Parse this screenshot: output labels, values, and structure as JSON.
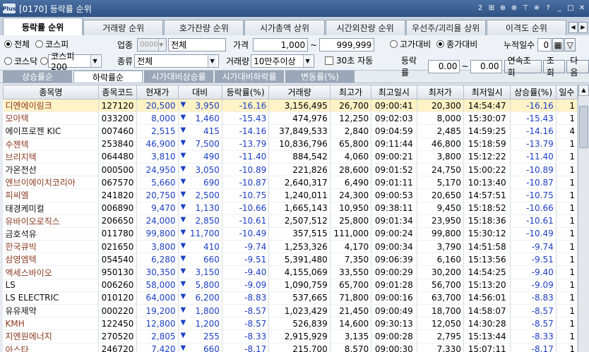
{
  "window": {
    "logo": "Plus",
    "title": "[0170] 등락률 순위"
  },
  "titlebar_icons": [
    "2",
    "⊞",
    "⊕",
    "⊗",
    "⊤",
    "※",
    "?",
    "_",
    "□",
    "✕"
  ],
  "tabs": [
    "등락률 순위",
    "거래량 순위",
    "호가잔량 순위",
    "시가총액 상위",
    "시간외잔량 순위",
    "우선주/괴리율 상위",
    "이격도 순위"
  ],
  "controls": {
    "market_all": "전체",
    "market_kospi": "코스피",
    "market_kosdaq": "코스닥",
    "market_kospi200": "코스피200",
    "industry_label": "업종",
    "industry_code": "0000",
    "industry_name": "전체",
    "type_label": "종류",
    "type_value": "전체",
    "price_label": "가격",
    "price_from": "1,000",
    "price_to": "999,999",
    "volume_label": "거래량",
    "volume_value": "10만주이상",
    "auto_label": "30초 자동",
    "vs_high": "고가대비",
    "vs_close": "종가대비",
    "days_label": "누적일수",
    "days_value": "0",
    "rate_label": "등락률",
    "rate_from": "0.00",
    "rate_to": "0.00",
    "btn_continuous": "연속조회",
    "btn_query": "조회",
    "btn_next": "다음",
    "tilde": "~"
  },
  "subtabs": [
    "상승률순",
    "하락률순",
    "시가대비상승률",
    "시가대비하락률",
    "변동률(%)"
  ],
  "columns": [
    "종목명",
    "종목코드",
    "현재가",
    "대비",
    "등락률(%)",
    "거래량",
    "최고가",
    "최고일시",
    "최저가",
    "최저일시",
    "상승률(%)",
    "일수"
  ],
  "rows": [
    {
      "name": "디엔에이링크",
      "code": "127120",
      "price": "20,500",
      "change": "3,950",
      "rate": "-16.16",
      "volume": "3,156,495",
      "high": "26,700",
      "high_time": "09:00:41",
      "low": "20,300",
      "low_time": "14:54:47",
      "up_rate": "-16.16",
      "days": "1",
      "kosdaq": true
    },
    {
      "name": "모아텍",
      "code": "033200",
      "price": "8,000",
      "change": "1,460",
      "rate": "-15.43",
      "volume": "474,976",
      "high": "12,250",
      "high_time": "09:02:03",
      "low": "8,000",
      "low_time": "15:30:07",
      "up_rate": "-15.43",
      "days": "1",
      "kosdaq": true
    },
    {
      "name": "에이프로젠 KIC",
      "code": "007460",
      "price": "2,515",
      "change": "415",
      "rate": "-14.16",
      "volume": "37,849,533",
      "high": "2,840",
      "high_time": "09:04:59",
      "low": "2,485",
      "low_time": "14:59:25",
      "up_rate": "-14.16",
      "days": "4",
      "kosdaq": false
    },
    {
      "name": "수젠텍",
      "code": "253840",
      "price": "46,900",
      "change": "7,500",
      "rate": "-13.79",
      "volume": "10,836,796",
      "high": "65,800",
      "high_time": "09:11:44",
      "low": "46,800",
      "low_time": "15:18:59",
      "up_rate": "-13.79",
      "days": "1",
      "kosdaq": true
    },
    {
      "name": "브리지텍",
      "code": "064480",
      "price": "3,810",
      "change": "490",
      "rate": "-11.40",
      "volume": "884,542",
      "high": "4,060",
      "high_time": "09:00:21",
      "low": "3,800",
      "low_time": "15:12:22",
      "up_rate": "-11.40",
      "days": "1",
      "kosdaq": true
    },
    {
      "name": "가온전선",
      "code": "000500",
      "price": "24,950",
      "change": "3,050",
      "rate": "-10.89",
      "volume": "221,826",
      "high": "28,600",
      "high_time": "09:01:52",
      "low": "24,750",
      "low_time": "15:00:22",
      "up_rate": "-10.89",
      "days": "1",
      "kosdaq": false
    },
    {
      "name": "엔브이에이치코리아",
      "code": "067570",
      "price": "5,660",
      "change": "690",
      "rate": "-10.87",
      "volume": "2,640,317",
      "high": "6,490",
      "high_time": "09:01:11",
      "low": "5,170",
      "low_time": "10:13:40",
      "up_rate": "-10.87",
      "days": "1",
      "kosdaq": true
    },
    {
      "name": "피씨엘",
      "code": "241820",
      "price": "20,750",
      "change": "2,500",
      "rate": "-10.75",
      "volume": "1,240,011",
      "high": "24,300",
      "high_time": "09:00:53",
      "low": "20,650",
      "low_time": "14:57:51",
      "up_rate": "-10.75",
      "days": "1",
      "kosdaq": true
    },
    {
      "name": "태경케미컬",
      "code": "006890",
      "price": "9,470",
      "change": "1,130",
      "rate": "-10.66",
      "volume": "1,665,143",
      "high": "10,950",
      "high_time": "09:38:11",
      "low": "9,450",
      "low_time": "15:18:52",
      "up_rate": "-10.66",
      "days": "1",
      "kosdaq": false
    },
    {
      "name": "유바이오로직스",
      "code": "206650",
      "price": "24,000",
      "change": "2,850",
      "rate": "-10.61",
      "volume": "2,507,512",
      "high": "25,800",
      "high_time": "09:01:34",
      "low": "23,950",
      "low_time": "15:18:36",
      "up_rate": "-10.61",
      "days": "1",
      "kosdaq": true
    },
    {
      "name": "금호석유",
      "code": "011780",
      "price": "99,800",
      "change": "11,700",
      "rate": "-10.49",
      "volume": "357,515",
      "high": "111,000",
      "high_time": "09:00:24",
      "low": "99,800",
      "low_time": "15:30:12",
      "up_rate": "-10.49",
      "days": "1",
      "kosdaq": false
    },
    {
      "name": "한국큐빅",
      "code": "021650",
      "price": "3,800",
      "change": "410",
      "rate": "-9.74",
      "volume": "1,253,326",
      "high": "4,170",
      "high_time": "09:00:34",
      "low": "3,790",
      "low_time": "14:51:58",
      "up_rate": "-9.74",
      "days": "1",
      "kosdaq": true
    },
    {
      "name": "삼영엠텍",
      "code": "054540",
      "price": "6,280",
      "change": "660",
      "rate": "-9.51",
      "volume": "5,391,480",
      "high": "7,350",
      "high_time": "09:06:39",
      "low": "6,160",
      "low_time": "15:13:56",
      "up_rate": "-9.51",
      "days": "1",
      "kosdaq": true
    },
    {
      "name": "엑세스바이오",
      "code": "950130",
      "price": "30,350",
      "change": "3,150",
      "rate": "-9.40",
      "volume": "4,155,069",
      "high": "33,550",
      "high_time": "09:00:29",
      "low": "30,200",
      "low_time": "14:54:25",
      "up_rate": "-9.40",
      "days": "1",
      "kosdaq": true
    },
    {
      "name": "LS",
      "code": "006260",
      "price": "58,000",
      "change": "5,800",
      "rate": "-9.09",
      "volume": "1,090,759",
      "high": "65,700",
      "high_time": "09:01:28",
      "low": "56,700",
      "low_time": "15:13:20",
      "up_rate": "-9.09",
      "days": "1",
      "kosdaq": false
    },
    {
      "name": "LS ELECTRIC",
      "code": "010120",
      "price": "64,000",
      "change": "6,200",
      "rate": "-8.83",
      "volume": "537,665",
      "high": "71,800",
      "high_time": "09:00:16",
      "low": "63,700",
      "low_time": "14:56:01",
      "up_rate": "-8.83",
      "days": "1",
      "kosdaq": false
    },
    {
      "name": "유유제약",
      "code": "000220",
      "price": "19,200",
      "change": "1,800",
      "rate": "-8.57",
      "volume": "1,023,429",
      "high": "21,450",
      "high_time": "09:00:49",
      "low": "18,700",
      "low_time": "14:58:07",
      "up_rate": "-8.57",
      "days": "1",
      "kosdaq": false
    },
    {
      "name": "KMH",
      "code": "122450",
      "price": "12,800",
      "change": "1,200",
      "rate": "-8.57",
      "volume": "526,839",
      "high": "14,600",
      "high_time": "09:30:13",
      "low": "12,050",
      "low_time": "14:30:28",
      "up_rate": "-8.57",
      "days": "1",
      "kosdaq": true
    },
    {
      "name": "지엔원에너지",
      "code": "270520",
      "price": "2,805",
      "change": "255",
      "rate": "-8.33",
      "volume": "2,915,929",
      "high": "3,135",
      "high_time": "09:00:28",
      "low": "2,795",
      "low_time": "15:13:44",
      "up_rate": "-8.33",
      "days": "1",
      "kosdaq": true
    },
    {
      "name": "아스타",
      "code": "246720",
      "price": "7,420",
      "change": "660",
      "rate": "-8.17",
      "volume": "215,700",
      "high": "8,570",
      "high_time": "09:00:30",
      "low": "7,330",
      "low_time": "15:07:11",
      "up_rate": "-8.17",
      "days": "1",
      "kosdaq": true
    }
  ],
  "colors": {
    "kosdaq_name": "#8b3a1f",
    "down": "#1b3fc4",
    "selected_row": "#fff2c5",
    "titlebar": "#2f5183"
  },
  "icons": {
    "down_arrow": "▼",
    "select_arrow": "▼",
    "calendar": "calendar-icon",
    "filter": "filter-icon"
  }
}
